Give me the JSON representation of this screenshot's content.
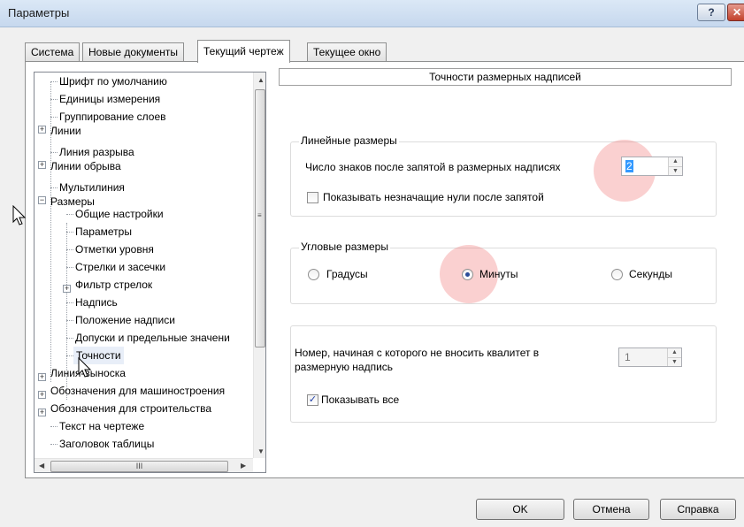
{
  "window": {
    "title": "Параметры",
    "help_label": "?",
    "close_label": "✕"
  },
  "tabs": [
    {
      "label": "Система"
    },
    {
      "label": "Новые документы"
    },
    {
      "label": "Текущий чертеж"
    },
    {
      "label": "Текущее окно"
    }
  ],
  "tree": {
    "items": [
      {
        "label": "Шрифт по умолчанию"
      },
      {
        "label": "Единицы измерения"
      },
      {
        "label": "Группирование слоев"
      },
      {
        "label": "Линии"
      },
      {
        "label": "Линия разрыва"
      },
      {
        "label": "Линии обрыва"
      },
      {
        "label": "Мультилиния"
      },
      {
        "label": "Размеры"
      },
      {
        "label": "Общие настройки"
      },
      {
        "label": "Параметры"
      },
      {
        "label": "Отметки уровня"
      },
      {
        "label": "Стрелки и засечки"
      },
      {
        "label": "Фильтр стрелок"
      },
      {
        "label": "Надпись"
      },
      {
        "label": "Положение надписи"
      },
      {
        "label": "Допуски и предельные значени"
      },
      {
        "label": "Точности"
      },
      {
        "label": "Линия-выноска"
      },
      {
        "label": "Обозначения для машиностроения"
      },
      {
        "label": "Обозначения для строительства"
      },
      {
        "label": "Текст на чертеже"
      },
      {
        "label": "Заголовок таблицы"
      }
    ],
    "hscroll_grip": "III"
  },
  "section": {
    "title": "Точности размерных надписей"
  },
  "linear": {
    "legend": "Линейные размеры",
    "digits_label": "Число знаков после запятой в размерных надписях",
    "digits_value": "2",
    "zeros_label": "Показывать незначащие нули после запятой",
    "zeros_checked": false
  },
  "angular": {
    "legend": "Угловые размеры",
    "options": [
      {
        "label": "Градусы",
        "selected": false
      },
      {
        "label": "Минуты",
        "selected": true
      },
      {
        "label": "Секунды",
        "selected": false
      }
    ]
  },
  "tolerance": {
    "label_line1": "Номер, начиная с которого не вносить квалитет в",
    "label_line2": "размерную надпись",
    "value": "1",
    "show_all_label": "Показывать все",
    "show_all_checked": true
  },
  "buttons": {
    "ok": "OK",
    "cancel": "Отмена",
    "help": "Справка"
  },
  "colors": {
    "highlight": "#f07878",
    "selection": "#3399ff"
  }
}
